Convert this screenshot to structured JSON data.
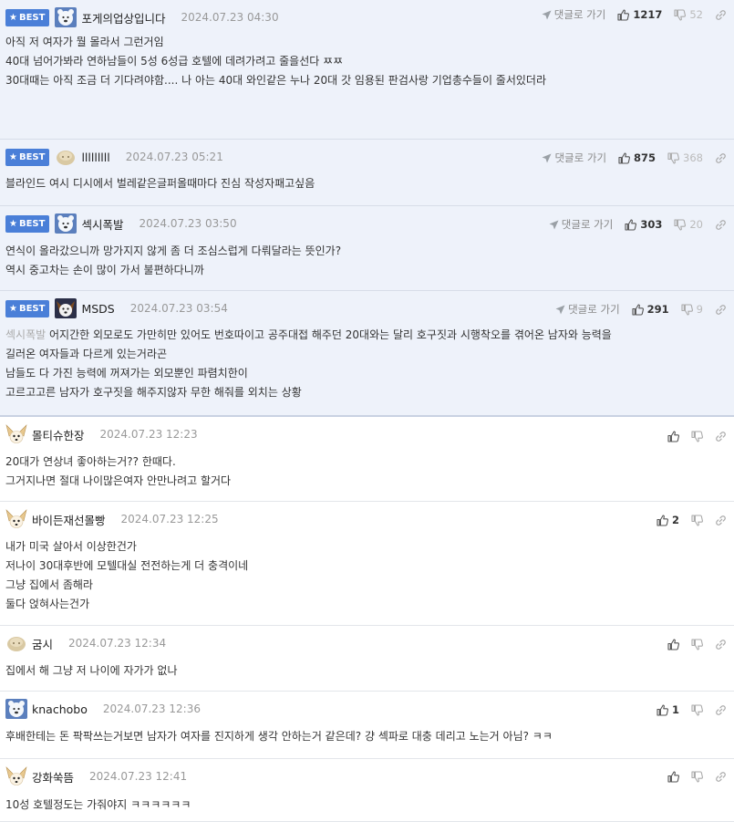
{
  "labels": {
    "best": "BEST",
    "reply": "댓글로 가기"
  },
  "colors": {
    "best_bg": "#eef2fa",
    "badge": "#4a7fd8"
  },
  "comments": [
    {
      "best": true,
      "avatar": "polar-bear-avatar",
      "nick": "포게의업상입니다",
      "date": "2024.07.23 04:30",
      "up": "1217",
      "down": "52",
      "lines": [
        "아직 저 여자가 뭘 몰라서 그런거임",
        "",
        "40대 넘어가봐라 연하남들이 5성 6성급 호텔에 데려가려고 줄을선다 ㅉㅉ",
        "",
        "30대때는 아직 조금 더 기다려야함.... 나 아는 40대 와인같은 누나 20대 갓 임용된 판검사랑 기업총수들이 줄서있더라"
      ]
    },
    {
      "best": true,
      "avatar": "potato-avatar",
      "nick": "lllllllll",
      "date": "2024.07.23 05:21",
      "up": "875",
      "down": "368",
      "lines": [
        "블라인드 여시 디시에서 벌레같은글퍼올때마다 진심 작성자패고싶음"
      ]
    },
    {
      "best": true,
      "avatar": "polar-bear-avatar",
      "nick": "섹시폭발",
      "date": "2024.07.23 03:50",
      "up": "303",
      "down": "20",
      "lines": [
        "연식이 올라갔으니까 망가지지 않게 좀 더 조심스럽게 다뤄달라는 뜻인가?",
        "역시 중고차는 손이 많이 가서 불편하다니까"
      ]
    },
    {
      "best": true,
      "avatar": "dog-avatar",
      "nick": "MSDS",
      "date": "2024.07.23 03:54",
      "up": "291",
      "down": "9",
      "deleted_prefix": "섹시폭발",
      "lines": [
        " 어지간한 외모로도 가만히만 있어도 번호따이고 공주대접 해주던 20대와는 달리 호구짓과 시행착오를 겪어온 남자와 능력을",
        "길러온 여자들과 다르게 있는거라곤",
        "남들도 다 가진 능력에 꺼져가는 외모뿐인 파렴치한이",
        "고르고고른 남자가 호구짓을 해주지않자 무한 해줘를 외치는 상황"
      ]
    },
    {
      "best": false,
      "avatar": "fennec-avatar",
      "nick": "몰티슈한장",
      "date": "2024.07.23 12:23",
      "up": "",
      "lines": [
        "20대가 연상녀 좋아하는거?? 한때다.",
        "그거지나면 절대 나이많은여자 안만나려고 할거다"
      ]
    },
    {
      "best": false,
      "avatar": "fennec-avatar",
      "nick": "바이든재선몰빵",
      "date": "2024.07.23 12:25",
      "up": "2",
      "lines": [
        "내가 미국 살아서 이상한건가",
        "저나이 30대후반에 모텔대실 전전하는게 더 충격이네",
        "그냥 집에서 좀해라",
        "둘다 얹혀사는건가"
      ]
    },
    {
      "best": false,
      "avatar": "potato-avatar",
      "nick": "굼시",
      "date": "2024.07.23 12:34",
      "up": "",
      "lines": [
        "집에서 해 그냥 저 나이에 자가가 없나"
      ]
    },
    {
      "best": false,
      "avatar": "polar-bear-avatar",
      "nick": "knachobo",
      "date": "2024.07.23 12:36",
      "up": "1",
      "lines": [
        "후배한테는 돈 팍팍쓰는거보면 남자가 여자를 진지하게 생각 안하는거 같은데? 걍 섹파로 대충 데리고 노는거 아님? ㅋㅋ"
      ]
    },
    {
      "best": false,
      "avatar": "fennec-avatar",
      "nick": "강화쑥뜸",
      "date": "2024.07.23 12:41",
      "up": "",
      "lines": [
        "10성 호텔정도는 가줘야지 ㅋㅋㅋㅋㅋㅋ"
      ]
    }
  ]
}
